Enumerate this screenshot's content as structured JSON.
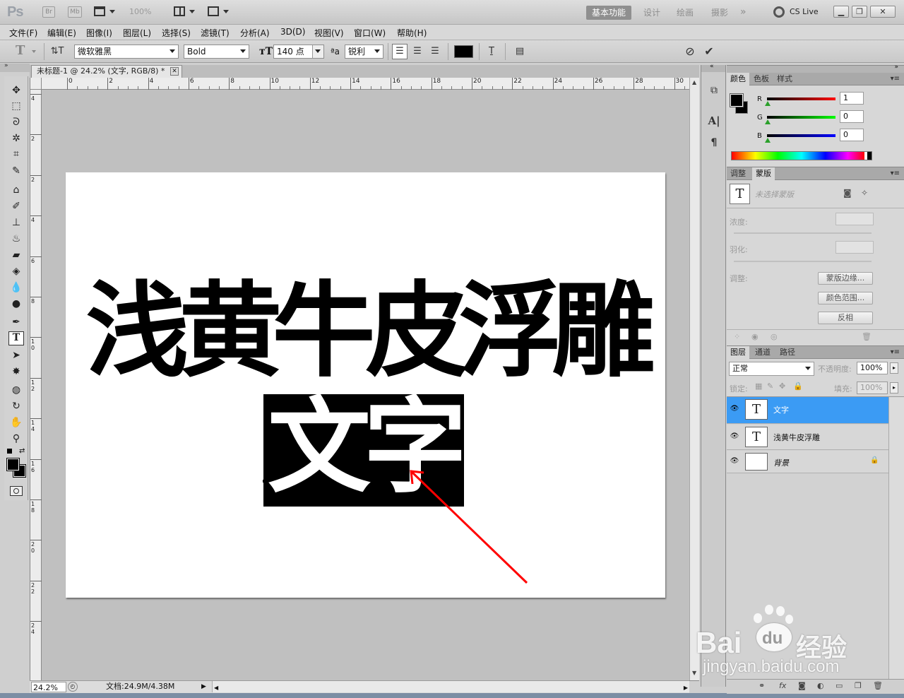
{
  "app": {
    "logo": "Ps",
    "bridge_icon": "Br",
    "minibridge_icon": "Mb",
    "zoom_select": "100%",
    "workspaces": [
      "基本功能",
      "设计",
      "绘画",
      "摄影"
    ],
    "cslive": "CS Live",
    "more_icon": "chevron-double-right-icon"
  },
  "menu": [
    "文件(F)",
    "编辑(E)",
    "图像(I)",
    "图层(L)",
    "选择(S)",
    "滤镜(T)",
    "分析(A)",
    "3D(D)",
    "视图(V)",
    "窗口(W)",
    "帮助(H)"
  ],
  "options": {
    "tool_glyph": "T",
    "font_family": "微软雅黑",
    "font_style": "Bold",
    "font_size": "140 点",
    "antialias_label": "ªa",
    "antialias": "锐利",
    "color_swatch": "#000000"
  },
  "document": {
    "tab_title": "未标题-1 @ 24.2% (文字, RGB/8) *",
    "ruler_h": [
      "0",
      "2",
      "4",
      "6",
      "8",
      "10",
      "12",
      "14",
      "16",
      "18",
      "20",
      "22",
      "24",
      "26",
      "28",
      "30"
    ],
    "ruler_v": [
      "4",
      "2",
      "2",
      "4",
      "6",
      "8",
      "1 0",
      "1 2",
      "1 4",
      "1 6",
      "1 8",
      "2 0",
      "2 2",
      "2 4"
    ],
    "title_text": "浅黄牛皮浮雕",
    "selected_text": "文字",
    "arrow_color": "#ff0000"
  },
  "status": {
    "zoom": "24.2%",
    "doc_info": "文档:24.9M/4.38M"
  },
  "color_panel": {
    "tabs": [
      "颜色",
      "色板",
      "样式"
    ],
    "r_label": "R",
    "g_label": "G",
    "b_label": "B",
    "r": "1",
    "g": "0",
    "b": "0"
  },
  "mask_panel": {
    "tabs": [
      "调整",
      "蒙版"
    ],
    "no_mask": "未选择蒙版",
    "density": "浓度:",
    "feather": "羽化:",
    "refine": "调整:",
    "btn_edge": "蒙版边缘...",
    "btn_range": "颜色范围...",
    "btn_invert": "反相"
  },
  "layers_panel": {
    "tabs": [
      "图层",
      "通道",
      "路径"
    ],
    "blend": "正常",
    "opacity_label": "不透明度:",
    "opacity": "100%",
    "lock_label": "锁定:",
    "fill_label": "填充:",
    "fill": "100%",
    "layers": [
      {
        "name": "文字",
        "thumb": "T",
        "selected": true
      },
      {
        "name": "浅黄牛皮浮雕",
        "thumb": "T",
        "selected": false
      },
      {
        "name": "背景",
        "thumb": "",
        "selected": false
      }
    ]
  },
  "watermark": {
    "brand": "Bai",
    "brand2": "du",
    "cn": "经验",
    "url": "jingyan.baidu.com"
  }
}
